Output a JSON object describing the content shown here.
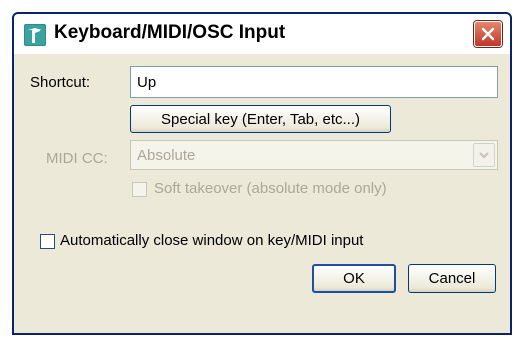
{
  "window": {
    "title": "Keyboard/MIDI/OSC Input",
    "icon": "reaper-app-icon",
    "close_icon": "close-icon"
  },
  "shortcut": {
    "label": "Shortcut:",
    "value": "Up"
  },
  "special_key_button": "Special key (Enter, Tab, etc...)",
  "midi_cc": {
    "label": "MIDI CC:",
    "selected": "Absolute",
    "disabled": true
  },
  "soft_takeover": {
    "label": "Soft takeover (absolute mode only)",
    "checked": false,
    "disabled": true
  },
  "auto_close": {
    "label": "Automatically close window on key/MIDI input",
    "checked": false
  },
  "buttons": {
    "ok": "OK",
    "cancel": "Cancel"
  },
  "colors": {
    "title_bar_frame": "#0a246a",
    "dialog_bg": "#ece9d8",
    "disabled_text": "#aca899",
    "close_button": "#c2352a"
  }
}
